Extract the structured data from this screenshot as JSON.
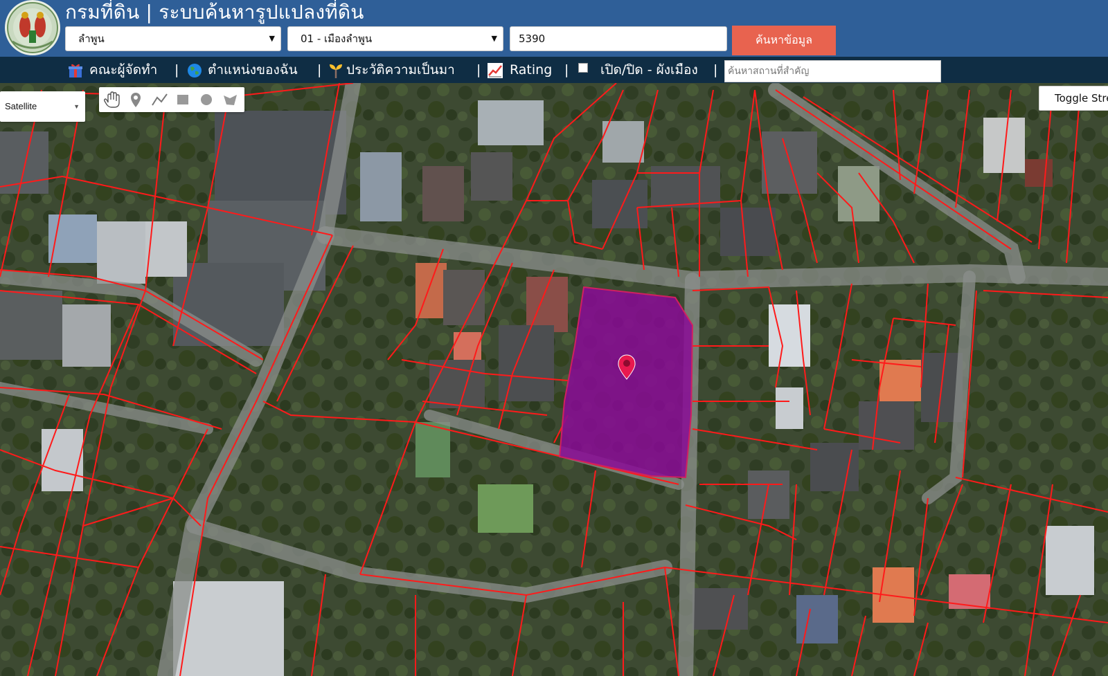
{
  "header": {
    "title": "กรมที่ดิน | ระบบค้นหารูปแปลงที่ดิน",
    "province": "ลำพูน",
    "district": "01 - เมืองลำพูน",
    "parcel_number": "5390",
    "search_button": "ค้นหาข้อมูล",
    "logo_icon": "department-seal-icon"
  },
  "navbar": {
    "items": [
      {
        "label": "คณะผู้จัดทำ",
        "icon": "gift-icon"
      },
      {
        "label": "ตำแหน่งของฉัน",
        "icon": "globe-icon"
      },
      {
        "label": "ประวัติความเป็นมา",
        "icon": "sprout-icon"
      },
      {
        "label": "Rating",
        "icon": "chart-icon"
      },
      {
        "label": "เปิด/ปิด - ผังเมือง",
        "icon": "checkbox-icon"
      }
    ],
    "separator": "|",
    "place_search_placeholder": "ค้นหาสถานที่สำคัญ"
  },
  "map": {
    "map_type": "Satellite",
    "toggle_street": "Toggle Street",
    "tools": [
      "hand-icon",
      "marker-icon",
      "polyline-icon",
      "rectangle-icon",
      "circle-icon",
      "polygon-icon"
    ],
    "colors": {
      "parcel_boundary": "#ff1a1a",
      "selected_parcel_fill": "#8a0a96",
      "marker": "#e8194f",
      "header_bg": "#2f5f98",
      "navbar_bg": "#0f2d44",
      "search_button": "#e8634f"
    }
  }
}
